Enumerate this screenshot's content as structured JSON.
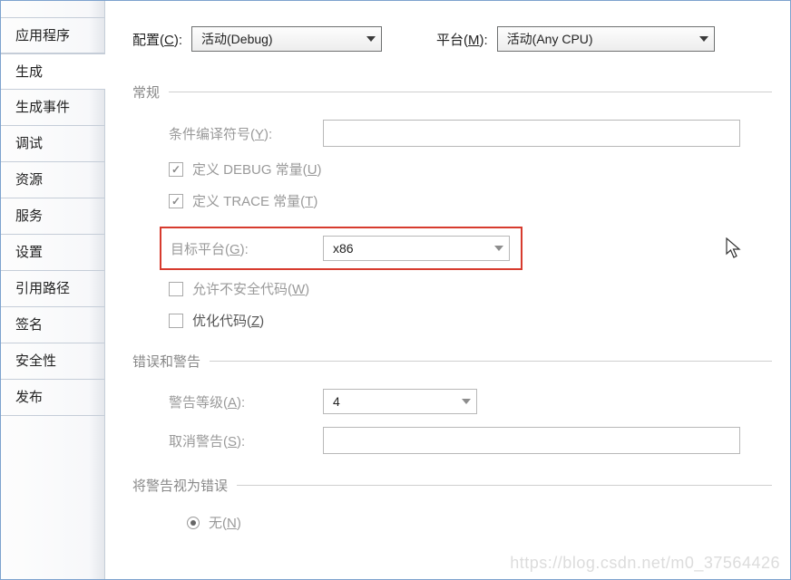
{
  "sidebar": {
    "items": [
      "应用程序",
      "生成",
      "生成事件",
      "调试",
      "资源",
      "服务",
      "设置",
      "引用路径",
      "签名",
      "安全性",
      "发布"
    ],
    "selected_index": 1
  },
  "header": {
    "config_label": "配置(C):",
    "config_value": "活动(Debug)",
    "platform_label": "平台(M):",
    "platform_value": "活动(Any CPU)"
  },
  "section_general": "常规",
  "fields": {
    "cond_symbols_label": "条件编译符号(Y):",
    "cond_symbols_value": "",
    "define_debug_label": "定义 DEBUG 常量(U)",
    "define_debug_checked": true,
    "define_trace_label": "定义 TRACE 常量(T)",
    "define_trace_checked": true,
    "target_platform_label": "目标平台(G):",
    "target_platform_value": "x86",
    "allow_unsafe_label": "允许不安全代码(W)",
    "allow_unsafe_checked": false,
    "optimize_label": "优化代码(Z)",
    "optimize_checked": false
  },
  "section_warnings": "错误和警告",
  "warnings": {
    "level_label": "警告等级(A):",
    "level_value": "4",
    "suppress_label": "取消警告(S):",
    "suppress_value": ""
  },
  "section_treat": "将警告视为错误",
  "treat": {
    "none_label": "无(N)",
    "none_selected": true
  },
  "watermark": "https://blog.csdn.net/m0_37564426"
}
